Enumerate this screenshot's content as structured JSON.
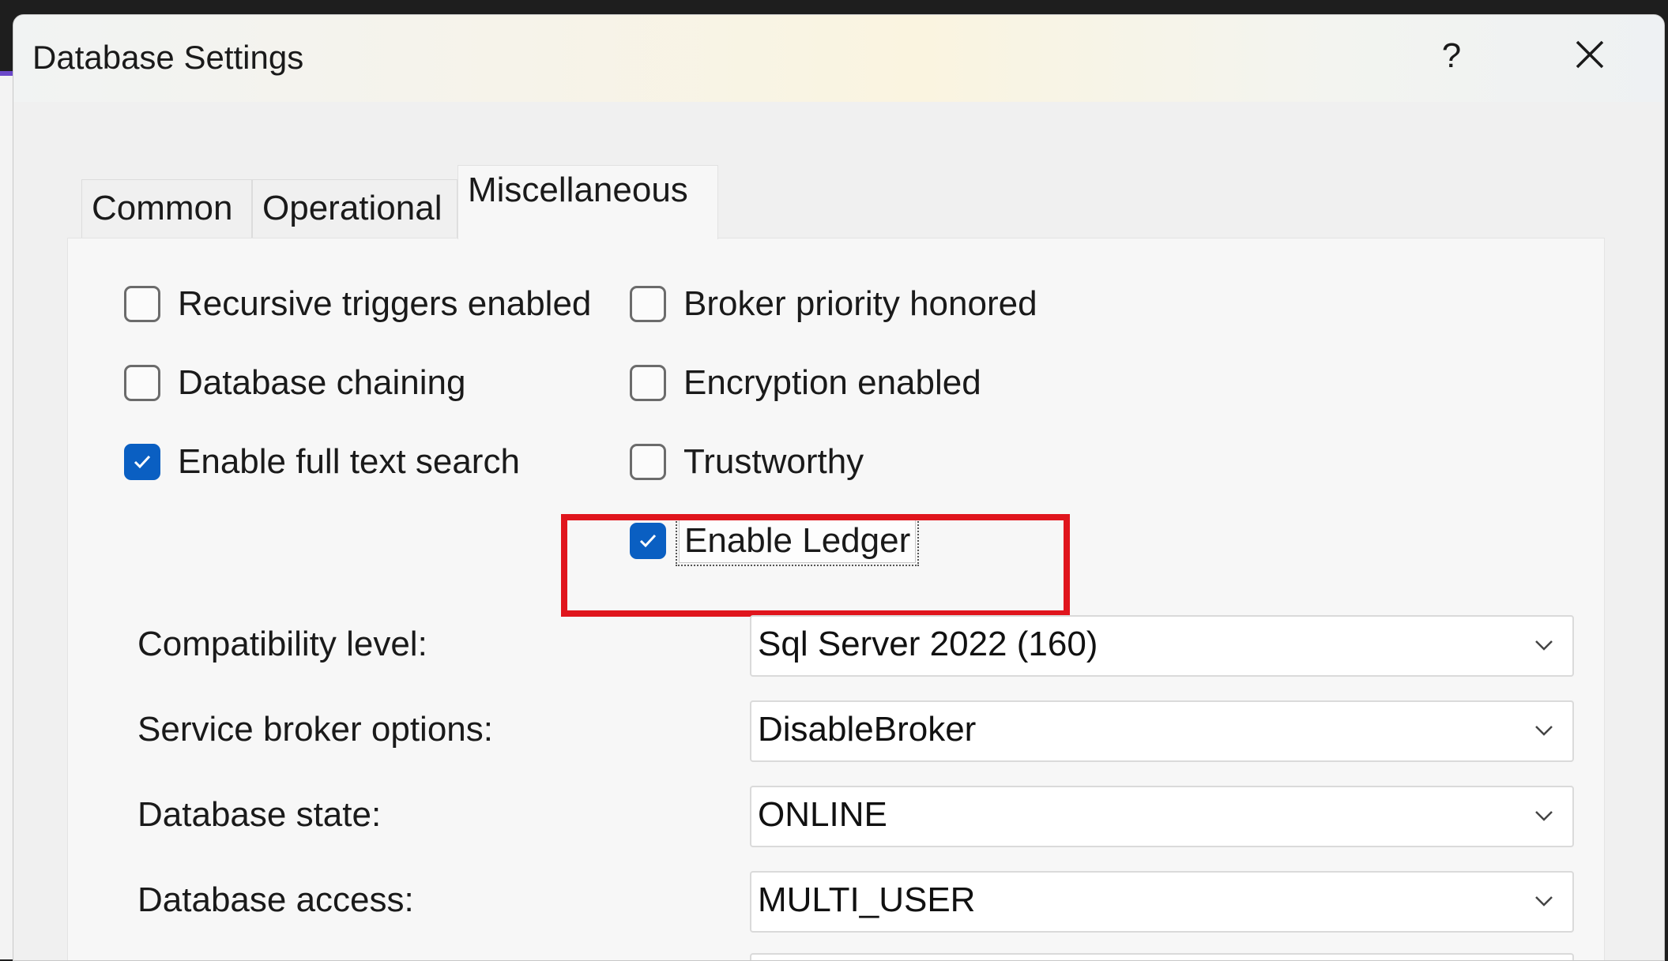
{
  "dialog": {
    "title": "Database Settings",
    "help_label": "?"
  },
  "tabs": [
    {
      "label": "Common",
      "active": false
    },
    {
      "label": "Operational",
      "active": false
    },
    {
      "label": "Miscellaneous",
      "active": true
    }
  ],
  "checkboxes": [
    {
      "label": "Recursive triggers enabled",
      "checked": false
    },
    {
      "label": "Database chaining",
      "checked": false
    },
    {
      "label": "Enable full text search",
      "checked": true
    },
    {
      "label": "Broker priority honored",
      "checked": false
    },
    {
      "label": "Encryption enabled",
      "checked": false
    },
    {
      "label": "Trustworthy",
      "checked": false
    },
    {
      "label": "Enable Ledger",
      "checked": true
    }
  ],
  "fields": [
    {
      "label": "Compatibility level:",
      "value": "Sql Server 2022 (160)"
    },
    {
      "label": "Service broker options:",
      "value": "DisableBroker"
    },
    {
      "label": "Database state:",
      "value": "ONLINE"
    },
    {
      "label": "Database access:",
      "value": "MULTI_USER"
    }
  ],
  "colors": {
    "accent": "#0a5fc2",
    "highlight": "#e0151d"
  }
}
